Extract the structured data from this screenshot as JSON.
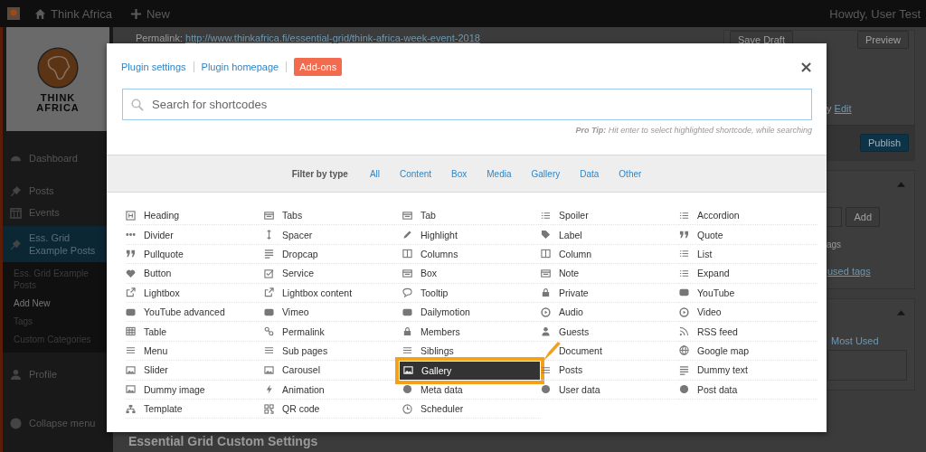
{
  "admin_bar": {
    "site": "Think Africa",
    "new": "New",
    "greeting": "Howdy, User Test"
  },
  "sidebar": {
    "logo": [
      "THINK",
      "AFRICA"
    ],
    "items": [
      {
        "label": "Dashboard",
        "selected": false
      },
      {
        "label": "Posts",
        "selected": false
      },
      {
        "label": "Events",
        "selected": false
      },
      {
        "label": "Ess. Grid Example Posts",
        "selected": true
      }
    ],
    "submenu": [
      {
        "label": "Ess. Grid Example Posts",
        "selected": false
      },
      {
        "label": "Add New",
        "selected": true
      },
      {
        "label": "Tags",
        "selected": false
      },
      {
        "label": "Custom Categories",
        "selected": false
      }
    ],
    "lower_items": [
      {
        "label": "Profile"
      }
    ],
    "collapse": "Collapse menu"
  },
  "editor": {
    "permalink_label": "Permalink:",
    "permalink_url": "http://www.thinkafrica.fi/essential-grid/think-africa-week-event-2018",
    "save_draft": "Save Draft",
    "preview": "Preview",
    "edit_prefix": "y",
    "edit_link": "Edit",
    "publish": "Publish",
    "add": "Add",
    "tags_hint": "ags",
    "used_tags": "used tags",
    "most_used": "Most Used",
    "section_title": "Essential Grid Custom Settings"
  },
  "modal": {
    "links": [
      {
        "label": "Plugin settings",
        "kind": "link"
      },
      {
        "label": "Plugin homepage",
        "kind": "link"
      },
      {
        "label": "Add-ons",
        "kind": "button"
      }
    ],
    "close": "×",
    "search": {
      "placeholder": "Search for shortcodes"
    },
    "pro_tip": "**Pro Tip:** Hit enter to select highlighted shortcode, while searching",
    "filter": {
      "label": "Filter by type",
      "types": [
        "All",
        "Content",
        "Box",
        "Media",
        "Gallery",
        "Data",
        "Other"
      ]
    },
    "shortcodes": [
      {
        "label": "Heading",
        "selected": false
      },
      {
        "label": "Tabs",
        "selected": false
      },
      {
        "label": "Tab",
        "selected": false
      },
      {
        "label": "Spoiler",
        "selected": false
      },
      {
        "label": "Accordion",
        "selected": false
      },
      {
        "label": "Divider",
        "selected": false
      },
      {
        "label": "Spacer",
        "selected": false
      },
      {
        "label": "Highlight",
        "selected": false
      },
      {
        "label": "Label",
        "selected": false
      },
      {
        "label": "Quote",
        "selected": false
      },
      {
        "label": "Pullquote",
        "selected": false
      },
      {
        "label": "Dropcap",
        "selected": false
      },
      {
        "label": "Columns",
        "selected": false
      },
      {
        "label": "Column",
        "selected": false
      },
      {
        "label": "List",
        "selected": false
      },
      {
        "label": "Button",
        "selected": false
      },
      {
        "label": "Service",
        "selected": false
      },
      {
        "label": "Box",
        "selected": false
      },
      {
        "label": "Note",
        "selected": false
      },
      {
        "label": "Expand",
        "selected": false
      },
      {
        "label": "Lightbox",
        "selected": false
      },
      {
        "label": "Lightbox content",
        "selected": false
      },
      {
        "label": "Tooltip",
        "selected": false
      },
      {
        "label": "Private",
        "selected": false
      },
      {
        "label": "YouTube",
        "selected": false
      },
      {
        "label": "YouTube advanced",
        "selected": false
      },
      {
        "label": "Vimeo",
        "selected": false
      },
      {
        "label": "Dailymotion",
        "selected": false
      },
      {
        "label": "Audio",
        "selected": false
      },
      {
        "label": "Video",
        "selected": false
      },
      {
        "label": "Table",
        "selected": false
      },
      {
        "label": "Permalink",
        "selected": false
      },
      {
        "label": "Members",
        "selected": false
      },
      {
        "label": "Guests",
        "selected": false
      },
      {
        "label": "RSS feed",
        "selected": false
      },
      {
        "label": "Menu",
        "selected": false
      },
      {
        "label": "Sub pages",
        "selected": false
      },
      {
        "label": "Siblings",
        "selected": false
      },
      {
        "label": "Document",
        "selected": false
      },
      {
        "label": "Google map",
        "selected": false
      },
      {
        "label": "Slider",
        "selected": false
      },
      {
        "label": "Carousel",
        "selected": false
      },
      {
        "label": "Gallery",
        "selected": true
      },
      {
        "label": "Posts",
        "selected": false
      },
      {
        "label": "Dummy text",
        "selected": false
      },
      {
        "label": "Dummy image",
        "selected": false
      },
      {
        "label": "Animation",
        "selected": false
      },
      {
        "label": "Meta data",
        "selected": false
      },
      {
        "label": "User data",
        "selected": false
      },
      {
        "label": "Post data",
        "selected": false
      },
      {
        "label": "Template",
        "selected": false
      },
      {
        "label": "QR code",
        "selected": false
      },
      {
        "label": "Scheduler",
        "selected": false
      }
    ]
  }
}
